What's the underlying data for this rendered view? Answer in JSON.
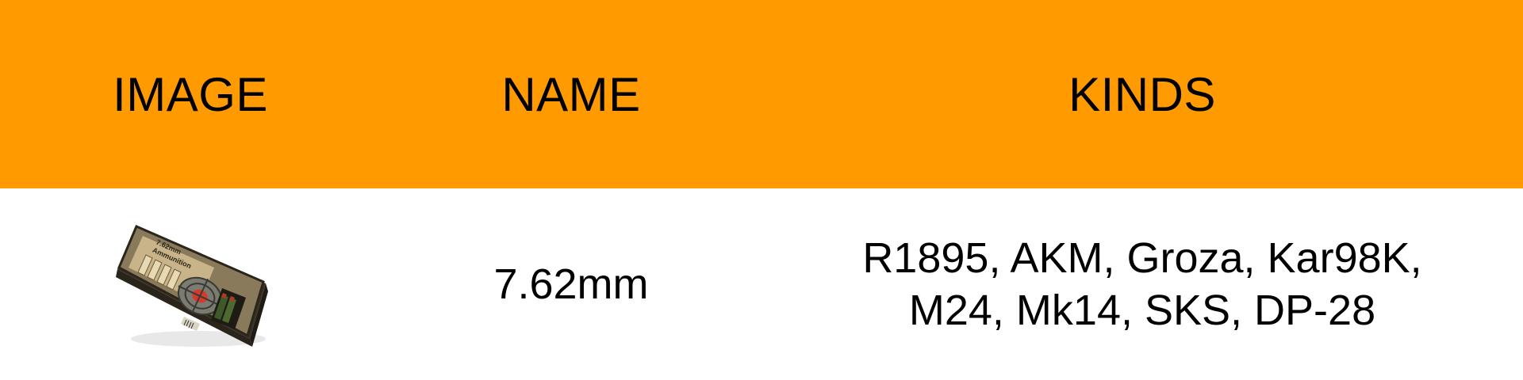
{
  "header": {
    "background_color": "#FF9A00",
    "columns": [
      "IMAGE",
      "NAME",
      "KINDS"
    ]
  },
  "rows": [
    {
      "image_icon": "ammo-box-icon",
      "image_label_lines": [
        "7.62mm",
        "Ammunition"
      ],
      "name": "7.62mm",
      "kinds": "R1895, AKM, Groza, Kar98K,\nM24, Mk14, SKS, DP-28"
    }
  ]
}
